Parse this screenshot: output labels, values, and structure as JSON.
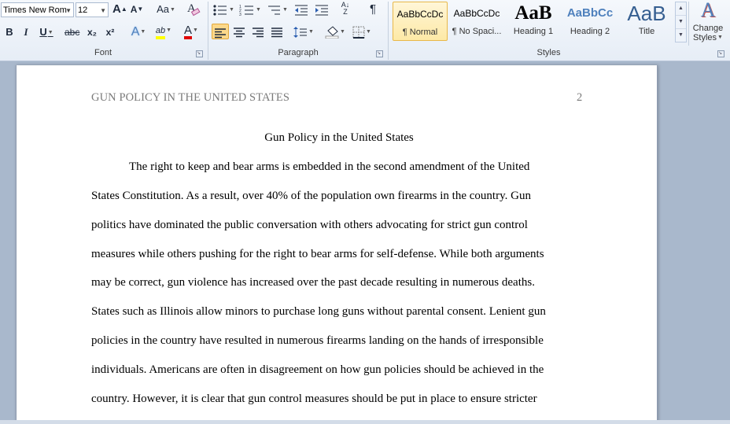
{
  "ribbon": {
    "font_group": {
      "label": "Font",
      "font_name": "Times New Rom",
      "font_size": "12",
      "grow_font": "A",
      "shrink_font": "A",
      "change_case": "Aa",
      "clear_format": "A",
      "bold": "B",
      "italic": "I",
      "underline": "U",
      "strikethrough": "abc",
      "subscript": "x₂",
      "superscript": "x²",
      "text_effects": "A",
      "highlight": "ab",
      "font_color": "A"
    },
    "paragraph_group": {
      "label": "Paragraph",
      "sort": "A↓Z",
      "show_marks": "¶"
    },
    "styles_group": {
      "label": "Styles",
      "styles": [
        {
          "sample": "AaBbCcDc",
          "name": "¶ Normal"
        },
        {
          "sample": "AaBbCcDc",
          "name": "¶ No Spaci..."
        },
        {
          "sample": "AaB",
          "name": "Heading 1"
        },
        {
          "sample": "AaBbCc",
          "name": "Heading 2"
        },
        {
          "sample": "AaB",
          "name": "Title"
        }
      ],
      "change_styles_line1": "Change",
      "change_styles_line2": "Styles"
    },
    "colors": {
      "highlight": "#ffff00",
      "font_color": "#e00000",
      "heading": "#365f91"
    }
  },
  "document": {
    "header": "GUN POLICY IN THE UNITED STATES",
    "page_number": "2",
    "title": "Gun Policy in the United States",
    "lines": [
      "The right to keep and bear arms is embedded in the second amendment of the United",
      "States Constitution. As a result, over 40% of the population own firearms in the country. Gun",
      "politics have dominated the public conversation with others advocating for strict gun control",
      "measures while others pushing for the right to bear arms for self-defense.  While both arguments",
      "may be correct, gun violence has increased over the past decade resulting in numerous deaths.",
      "States such as Illinois allow minors to purchase long guns without parental consent. Lenient gun",
      "policies in the country have resulted in numerous firearms landing on the hands of irresponsible",
      "individuals. Americans are often in disagreement on how gun policies should be achieved in the",
      "country. However, it is clear that gun control measures should be put in place to ensure stricter"
    ]
  }
}
